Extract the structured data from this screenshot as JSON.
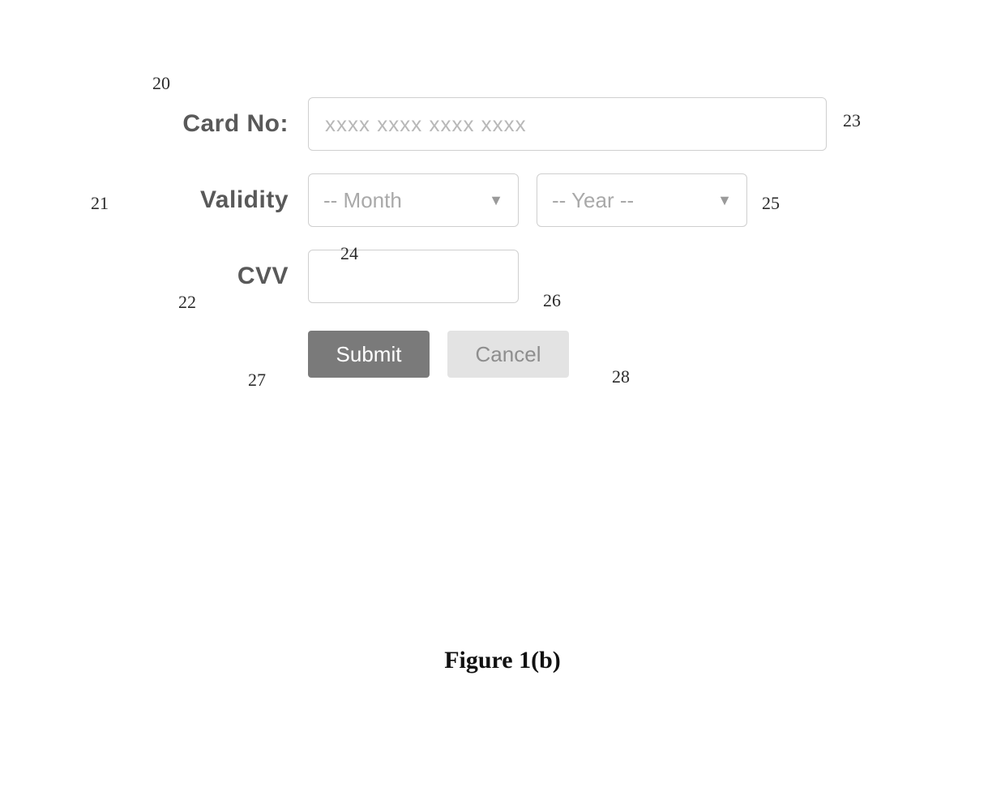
{
  "labels": {
    "card_no": "Card No:",
    "validity": "Validity",
    "cvv": "CVV"
  },
  "inputs": {
    "card_placeholder": "xxxx xxxx xxxx xxxx",
    "month_placeholder": "-- Month",
    "year_placeholder": "-- Year --",
    "cvv_value": ""
  },
  "buttons": {
    "submit": "Submit",
    "cancel": "Cancel"
  },
  "callouts": {
    "c20": "20",
    "c21": "21",
    "c22": "22",
    "c23": "23",
    "c24": "24",
    "c25": "25",
    "c26": "26",
    "c27": "27",
    "c28": "28"
  },
  "caption": "Figure 1(b)"
}
